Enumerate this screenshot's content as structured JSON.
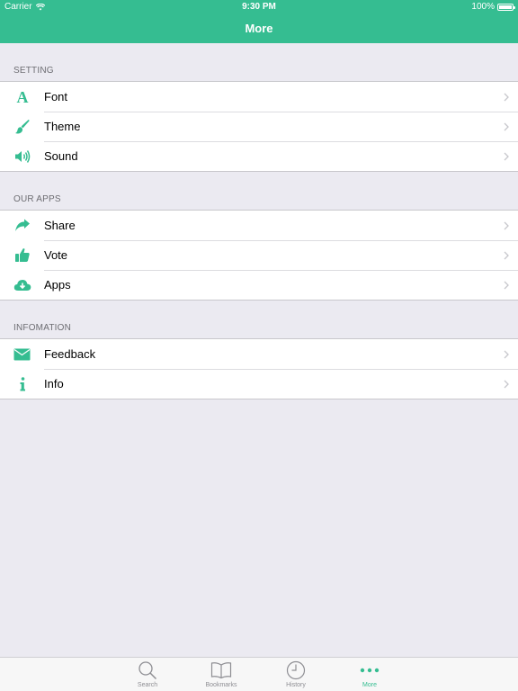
{
  "status_bar": {
    "carrier": "Carrier",
    "time": "9:30 PM",
    "battery": "100%"
  },
  "nav": {
    "title": "More"
  },
  "sections": [
    {
      "header": "SETTING",
      "items": [
        {
          "label": "Font",
          "icon": "font-icon"
        },
        {
          "label": "Theme",
          "icon": "brush-icon"
        },
        {
          "label": "Sound",
          "icon": "speaker-icon"
        }
      ]
    },
    {
      "header": "OUR APPS",
      "items": [
        {
          "label": "Share",
          "icon": "share-icon"
        },
        {
          "label": "Vote",
          "icon": "thumbs-up-icon"
        },
        {
          "label": "Apps",
          "icon": "cloud-download-icon"
        }
      ]
    },
    {
      "header": "INFOMATION",
      "items": [
        {
          "label": "Feedback",
          "icon": "envelope-icon"
        },
        {
          "label": "Info",
          "icon": "info-icon"
        }
      ]
    }
  ],
  "tabs": [
    {
      "label": "Search",
      "icon": "search-icon",
      "active": false
    },
    {
      "label": "Bookmarks",
      "icon": "book-icon",
      "active": false
    },
    {
      "label": "History",
      "icon": "clock-icon",
      "active": false
    },
    {
      "label": "More",
      "icon": "more-dots-icon",
      "active": true
    }
  ],
  "colors": {
    "accent": "#35bd91",
    "background": "#ebeaf1",
    "inactive_tab": "#8e8e93"
  }
}
